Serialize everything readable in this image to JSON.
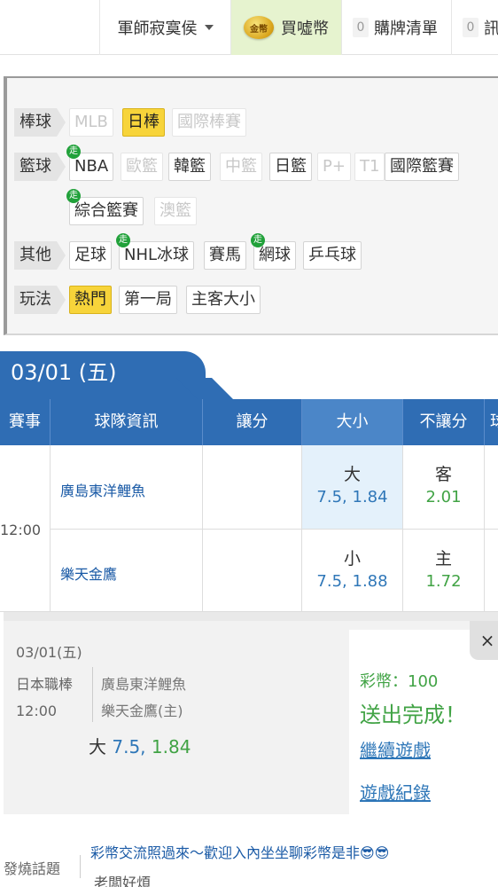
{
  "nav": {
    "user": "軍師寂寞侯",
    "buy_coin_icon_text": "金幣",
    "buy_label": "買噓幣",
    "bet_list_count": "0",
    "bet_list_label": "購牌清單",
    "message_count": "0",
    "message_label": "訊"
  },
  "filters": {
    "baseball": {
      "label": "棒球",
      "items": [
        "MLB",
        "日棒",
        "國際棒賽"
      ]
    },
    "basketball": {
      "label": "籃球",
      "items": [
        "NBA",
        "歐籃",
        "韓籃",
        "中籃",
        "日籃",
        "P+",
        "T1",
        "國際籃賽",
        "綜合籃賽",
        "澳籃"
      ]
    },
    "other": {
      "label": "其他",
      "items": [
        "足球",
        "NHL冰球",
        "賽馬",
        "網球",
        "乒乓球"
      ]
    },
    "play": {
      "label": "玩法",
      "items": [
        "熱門",
        "第一局",
        "主客大小"
      ]
    },
    "walk_badge": "走"
  },
  "date_tab": "03/01 (五)",
  "table": {
    "headers": [
      "賽事",
      "球隊資訊",
      "讓分",
      "大小",
      "不讓分",
      "球"
    ],
    "time": "12:00",
    "rows": [
      {
        "team": "廣島東洋鯉魚",
        "ou_label": "大",
        "ou_value": "7.5, 1.84",
        "ml_label": "客",
        "ml_value": "2.01"
      },
      {
        "team": "樂天金鷹",
        "ou_label": "小",
        "ou_value": "7.5, 1.88",
        "ml_label": "主",
        "ml_value": "1.72"
      }
    ]
  },
  "confirm": {
    "date": "03/01(五)",
    "league": "日本職棒",
    "time": "12:00",
    "team_away": "廣島東洋鯉魚",
    "team_home": "樂天金鷹(主)",
    "pick_label": "大",
    "pick_line": "7.5,",
    "pick_odds": "1.84",
    "coins": "彩幣：100",
    "status": "送出完成！",
    "continue_link": "繼續遊戲",
    "history_link": "遊戲紀錄",
    "close": "×"
  },
  "hot": {
    "label": "發燒話題",
    "text": "彩幣交流照過來～歡迎入內坐坐聊彩幣是非😎😎",
    "user": "老闆好煩"
  }
}
